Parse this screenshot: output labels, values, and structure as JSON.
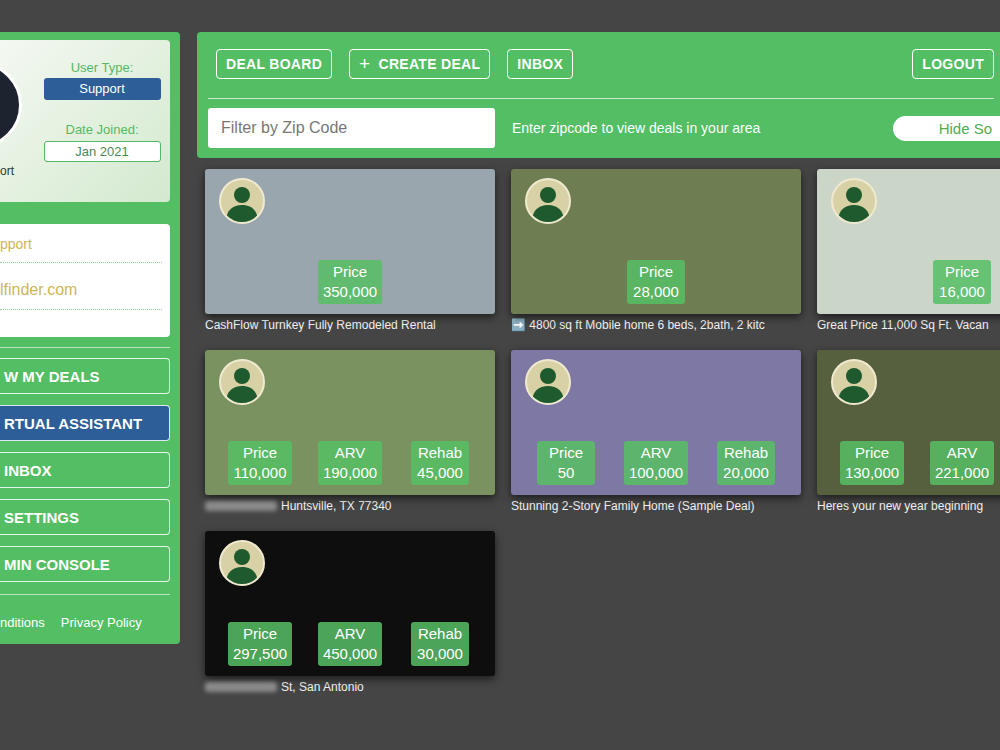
{
  "sidebar": {
    "profile": {
      "name": "ort",
      "user_type_label": "User Type:",
      "user_type": "Support",
      "date_joined_label": "Date Joined:",
      "date_joined": "Jan 2021"
    },
    "contact": [
      "pport",
      "lfinder.com"
    ],
    "menu": [
      {
        "label": "W MY DEALS",
        "selected": false
      },
      {
        "label": "RTUAL ASSISTANT",
        "selected": true
      },
      {
        "label": "INBOX",
        "selected": false
      },
      {
        "label": "SETTINGS",
        "selected": false
      },
      {
        "label": "MIN CONSOLE",
        "selected": false
      }
    ],
    "footer_links": [
      "nditions",
      "Privacy Policy"
    ]
  },
  "toolbar": {
    "buttons": [
      {
        "label": "DEAL BOARD",
        "icon": ""
      },
      {
        "label": "CREATE DEAL",
        "icon": "+"
      },
      {
        "label": "INBOX",
        "icon": ""
      }
    ],
    "logout": "LOGOUT"
  },
  "filter": {
    "placeholder": "Filter by Zip Code",
    "hint": "Enter zipcode to view deals in your area",
    "toggle": "Hide So"
  },
  "deals": [
    {
      "caption": "CashFlow Turnkey Fully Remodeled Rental",
      "address_hidden": false,
      "stats": [
        {
          "label": "Price",
          "value": "350,000"
        }
      ]
    },
    {
      "caption": "➡️ 4800 sq ft Mobile home 6 beds, 2bath, 2 kitc",
      "address_hidden": false,
      "stats": [
        {
          "label": "Price",
          "value": "28,000"
        }
      ]
    },
    {
      "caption": "Great Price 11,000 Sq Ft. Vacan",
      "address_hidden": false,
      "stats": [
        {
          "label": "Price",
          "value": "16,000"
        }
      ]
    },
    {
      "caption": "Huntsville, TX 77340",
      "address_hidden": true,
      "stats": [
        {
          "label": "Price",
          "value": "110,000"
        },
        {
          "label": "ARV",
          "value": "190,000"
        },
        {
          "label": "Rehab",
          "value": "45,000"
        }
      ]
    },
    {
      "caption": "Stunning 2-Story Family Home (Sample Deal)",
      "address_hidden": false,
      "stats": [
        {
          "label": "Price",
          "value": "50"
        },
        {
          "label": "ARV",
          "value": "100,000"
        },
        {
          "label": "Rehab",
          "value": "20,000"
        }
      ]
    },
    {
      "caption": "Heres your new year beginning",
      "address_hidden": false,
      "stats": [
        {
          "label": "Price",
          "value": "130,000"
        },
        {
          "label": "ARV",
          "value": "221,000"
        }
      ]
    },
    {
      "caption": "St, San Antonio",
      "address_hidden": true,
      "stats": [
        {
          "label": "Price",
          "value": "297,500"
        },
        {
          "label": "ARV",
          "value": "450,000"
        },
        {
          "label": "Rehab",
          "value": "30,000"
        }
      ]
    }
  ]
}
